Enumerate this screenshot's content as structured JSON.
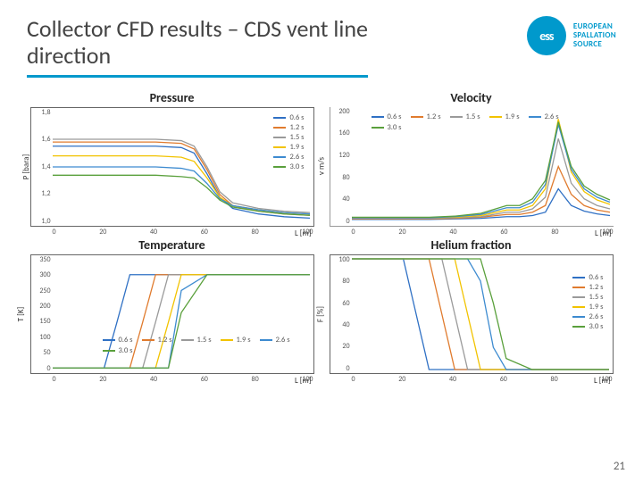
{
  "header": {
    "title_line1": "Collector CFD results – CDS vent line",
    "title_line2": "direction",
    "org_name_l1": "EUROPEAN",
    "org_name_l2": "SPALLATION",
    "org_name_l3": "SOURCE",
    "logo_text": "ess"
  },
  "page_number": "21",
  "series_colors": {
    "s06": "#2f70c4",
    "s12": "#e07b2e",
    "s15": "#9a9a9a",
    "s19": "#f2c300",
    "s26": "#3d8bd0",
    "s30": "#5aa03c"
  },
  "series_labels": {
    "s06": "0.6 s",
    "s12": "1.2 s",
    "s15": "1.5 s",
    "s19": "1.9 s",
    "s26": "2.6 s",
    "s30": "3.0 s"
  },
  "charts": {
    "pressure": {
      "title": "Pressure",
      "ylabel": "P [bara]",
      "xlabel": "L [m]",
      "y_ticks": [
        "1,8",
        "1,6",
        "1,4",
        "1,2",
        "1,0"
      ],
      "x_ticks": [
        "0",
        "20",
        "40",
        "60",
        "80",
        "100"
      ]
    },
    "velocity": {
      "title": "Velocity",
      "ylabel": "v m/s",
      "xlabel": "L [m]",
      "y_ticks": [
        "200",
        "160",
        "120",
        "80",
        "40",
        "0"
      ],
      "x_ticks": [
        "0",
        "20",
        "40",
        "60",
        "80",
        "100"
      ]
    },
    "temperature": {
      "title": "Temperature",
      "ylabel": "T [K]",
      "xlabel": "L [m]",
      "y_ticks": [
        "350",
        "300",
        "250",
        "200",
        "150",
        "100",
        "50",
        "0"
      ],
      "x_ticks": [
        "0",
        "20",
        "40",
        "60",
        "80",
        "100"
      ]
    },
    "helium": {
      "title": "Helium fraction",
      "ylabel": "F [%]",
      "xlabel": "L [m]",
      "y_ticks": [
        "100",
        "80",
        "60",
        "40",
        "20",
        "0"
      ],
      "x_ticks": [
        "0",
        "20",
        "40",
        "60",
        "80",
        "100"
      ]
    }
  },
  "chart_data": [
    {
      "type": "line",
      "title": "Pressure",
      "xlabel": "L [m]",
      "ylabel": "P [bara]",
      "xlim": [
        0,
        100
      ],
      "ylim": [
        1.0,
        1.8
      ],
      "x": [
        0,
        10,
        20,
        30,
        40,
        50,
        55,
        60,
        65,
        70,
        80,
        90,
        100
      ],
      "series": [
        {
          "name": "0.6 s",
          "values": [
            1.55,
            1.55,
            1.55,
            1.55,
            1.55,
            1.54,
            1.5,
            1.35,
            1.18,
            1.1,
            1.06,
            1.04,
            1.03
          ]
        },
        {
          "name": "1.2 s",
          "values": [
            1.58,
            1.58,
            1.58,
            1.58,
            1.58,
            1.57,
            1.53,
            1.38,
            1.2,
            1.12,
            1.08,
            1.06,
            1.05
          ]
        },
        {
          "name": "1.5 s",
          "values": [
            1.6,
            1.6,
            1.6,
            1.6,
            1.6,
            1.59,
            1.55,
            1.4,
            1.22,
            1.14,
            1.1,
            1.08,
            1.07
          ]
        },
        {
          "name": "1.9 s",
          "values": [
            1.48,
            1.48,
            1.48,
            1.48,
            1.48,
            1.47,
            1.44,
            1.32,
            1.18,
            1.12,
            1.09,
            1.07,
            1.06
          ]
        },
        {
          "name": "2.6 s",
          "values": [
            1.4,
            1.4,
            1.4,
            1.4,
            1.4,
            1.39,
            1.37,
            1.28,
            1.17,
            1.12,
            1.09,
            1.07,
            1.06
          ]
        },
        {
          "name": "3.0 s",
          "values": [
            1.34,
            1.34,
            1.34,
            1.34,
            1.34,
            1.33,
            1.32,
            1.25,
            1.16,
            1.11,
            1.08,
            1.06,
            1.05
          ]
        }
      ]
    },
    {
      "type": "line",
      "title": "Velocity",
      "xlabel": "L [m]",
      "ylabel": "v m/s",
      "xlim": [
        0,
        100
      ],
      "ylim": [
        0,
        200
      ],
      "x": [
        0,
        10,
        20,
        30,
        40,
        50,
        60,
        65,
        70,
        75,
        80,
        85,
        90,
        95,
        100
      ],
      "series": [
        {
          "name": "0.6 s",
          "values": [
            5,
            5,
            5,
            5,
            6,
            7,
            10,
            10,
            12,
            18,
            60,
            30,
            20,
            15,
            12
          ]
        },
        {
          "name": "1.2 s",
          "values": [
            6,
            6,
            6,
            6,
            7,
            9,
            14,
            14,
            18,
            30,
            100,
            50,
            30,
            22,
            18
          ]
        },
        {
          "name": "1.5 s",
          "values": [
            7,
            7,
            7,
            7,
            8,
            10,
            18,
            18,
            24,
            45,
            150,
            70,
            42,
            30,
            24
          ]
        },
        {
          "name": "1.9 s",
          "values": [
            8,
            8,
            8,
            8,
            9,
            12,
            22,
            22,
            30,
            60,
            185,
            90,
            55,
            40,
            32
          ]
        },
        {
          "name": "2.6 s",
          "values": [
            8,
            8,
            8,
            8,
            10,
            14,
            26,
            26,
            36,
            68,
            175,
            95,
            60,
            45,
            36
          ]
        },
        {
          "name": "3.0 s",
          "values": [
            9,
            9,
            9,
            9,
            11,
            16,
            30,
            30,
            42,
            75,
            180,
            100,
            65,
            50,
            40
          ]
        }
      ]
    },
    {
      "type": "line",
      "title": "Temperature",
      "xlabel": "L [m]",
      "ylabel": "T [K]",
      "xlim": [
        0,
        100
      ],
      "ylim": [
        0,
        350
      ],
      "x": [
        0,
        5,
        10,
        15,
        20,
        25,
        30,
        35,
        40,
        45,
        50,
        60,
        70,
        80,
        90,
        100
      ],
      "series": [
        {
          "name": "0.6 s",
          "values": [
            5,
            5,
            5,
            5,
            5,
            150,
            300,
            300,
            300,
            300,
            300,
            300,
            300,
            300,
            300,
            300
          ]
        },
        {
          "name": "1.2 s",
          "values": [
            5,
            5,
            5,
            5,
            5,
            5,
            5,
            150,
            300,
            300,
            300,
            300,
            300,
            300,
            300,
            300
          ]
        },
        {
          "name": "1.5 s",
          "values": [
            5,
            5,
            5,
            5,
            5,
            5,
            5,
            5,
            150,
            300,
            300,
            300,
            300,
            300,
            300,
            300
          ]
        },
        {
          "name": "1.9 s",
          "values": [
            5,
            5,
            5,
            5,
            5,
            5,
            5,
            5,
            5,
            150,
            300,
            300,
            300,
            300,
            300,
            300
          ]
        },
        {
          "name": "2.6 s",
          "values": [
            5,
            5,
            5,
            5,
            5,
            5,
            5,
            5,
            5,
            5,
            250,
            300,
            300,
            300,
            300,
            300
          ]
        },
        {
          "name": "3.0 s",
          "values": [
            5,
            5,
            5,
            5,
            5,
            5,
            5,
            5,
            5,
            5,
            180,
            300,
            300,
            300,
            300,
            300
          ]
        }
      ]
    },
    {
      "type": "line",
      "title": "Helium fraction",
      "xlabel": "L [m]",
      "ylabel": "F [%]",
      "xlim": [
        0,
        100
      ],
      "ylim": [
        0,
        100
      ],
      "x": [
        0,
        5,
        10,
        15,
        20,
        25,
        30,
        35,
        40,
        45,
        50,
        55,
        60,
        70,
        80,
        90,
        100
      ],
      "series": [
        {
          "name": "0.6 s",
          "values": [
            100,
            100,
            100,
            100,
            100,
            50,
            0,
            0,
            0,
            0,
            0,
            0,
            0,
            0,
            0,
            0,
            0
          ]
        },
        {
          "name": "1.2 s",
          "values": [
            100,
            100,
            100,
            100,
            100,
            100,
            100,
            50,
            0,
            0,
            0,
            0,
            0,
            0,
            0,
            0,
            0
          ]
        },
        {
          "name": "1.5 s",
          "values": [
            100,
            100,
            100,
            100,
            100,
            100,
            100,
            100,
            50,
            0,
            0,
            0,
            0,
            0,
            0,
            0,
            0
          ]
        },
        {
          "name": "1.9 s",
          "values": [
            100,
            100,
            100,
            100,
            100,
            100,
            100,
            100,
            100,
            50,
            0,
            0,
            0,
            0,
            0,
            0,
            0
          ]
        },
        {
          "name": "2.6 s",
          "values": [
            100,
            100,
            100,
            100,
            100,
            100,
            100,
            100,
            100,
            100,
            80,
            20,
            0,
            0,
            0,
            0,
            0
          ]
        },
        {
          "name": "3.0 s",
          "values": [
            100,
            100,
            100,
            100,
            100,
            100,
            100,
            100,
            100,
            100,
            100,
            60,
            10,
            0,
            0,
            0,
            0
          ]
        }
      ]
    }
  ]
}
